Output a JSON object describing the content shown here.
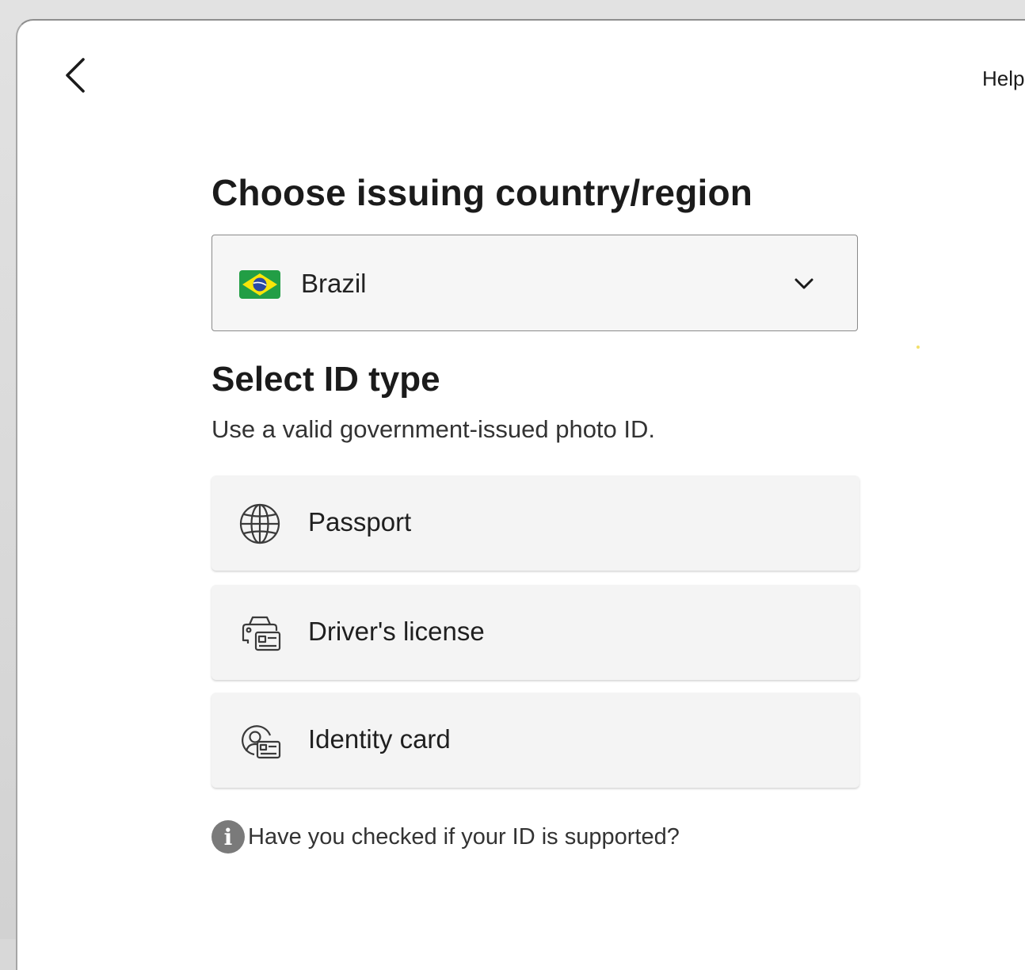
{
  "header": {
    "help_label": "Help"
  },
  "country_section": {
    "title": "Choose issuing country/region",
    "selected_country": "Brazil",
    "flag_icon": "brazil-flag-icon"
  },
  "id_section": {
    "title": "Select ID type",
    "subtitle": "Use a valid government-issued photo ID.",
    "options": [
      {
        "label": "Passport",
        "icon": "globe-icon"
      },
      {
        "label": "Driver's license",
        "icon": "car-id-card-icon"
      },
      {
        "label": "Identity card",
        "icon": "person-id-card-icon"
      }
    ]
  },
  "info": {
    "text": "Have you checked if your ID is supported?",
    "icon": "info-icon"
  },
  "colors": {
    "background": "#ffffff",
    "card": "#f4f4f4",
    "text": "#1b1b1b",
    "border": "#8a8a8a",
    "flag_green": "#229e45",
    "flag_yellow": "#f8e509",
    "flag_blue": "#2b49a3"
  }
}
